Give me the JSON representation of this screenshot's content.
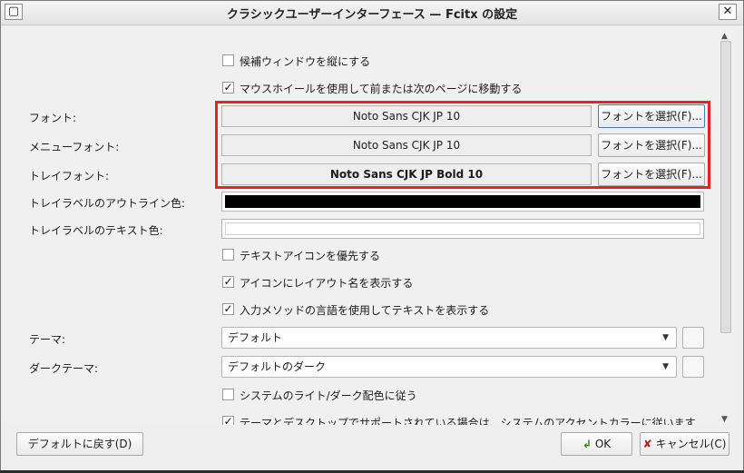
{
  "window": {
    "title": "クラシックユーザーインターフェース — Fcitx の設定",
    "left_btn_icon": "window-menu-icon",
    "close_glyph": "✕",
    "close_icon": "close-icon"
  },
  "checkboxes": {
    "vertical_candidates": {
      "label": "候補ウィンドウを縦にする",
      "checked": false
    },
    "wheel_paging": {
      "label": "マウスホイールを使用して前または次のページに移動する",
      "checked": true
    },
    "prefer_text_icon": {
      "label": "テキストアイコンを優先する",
      "checked": false
    },
    "show_layout_name": {
      "label": "アイコンにレイアウト名を表示する",
      "checked": true
    },
    "show_lang_text": {
      "label": "入力メソッドの言語を使用してテキストを表示する",
      "checked": true
    },
    "follow_system_dark": {
      "label": "システムのライト/ダーク配色に従う",
      "checked": false
    },
    "accent_color": {
      "label": "テーマとデスクトップでサポートされている場合は、システムのアクセントカラーに従います",
      "checked": true
    }
  },
  "fonts": {
    "font": {
      "label": "フォント:",
      "value": "Noto Sans CJK JP 10",
      "button": "フォントを選択(F)..."
    },
    "menu_font": {
      "label": "メニューフォント:",
      "value": "Noto Sans CJK JP 10",
      "button": "フォントを選択(F)..."
    },
    "tray_font": {
      "label": "トレイフォント:",
      "value": "Noto Sans CJK JP Bold 10",
      "button": "フォントを選択(F)..."
    }
  },
  "colors": {
    "tray_outline": {
      "label": "トレイラベルのアウトライン色:",
      "color": "#000000"
    },
    "tray_text": {
      "label": "トレイラベルのテキスト色:",
      "color": "#ffffff"
    }
  },
  "theme": {
    "label": "テーマ:",
    "value": "デフォルト",
    "dark_label": "ダークテーマ:",
    "dark_value": "デフォルトのダーク"
  },
  "footer": {
    "defaults_button": "デフォルトに戻す(D)",
    "ok_button": "OK",
    "cancel_button": "キャンセル(C)"
  },
  "accent": {
    "highlight": "#e8202a"
  }
}
